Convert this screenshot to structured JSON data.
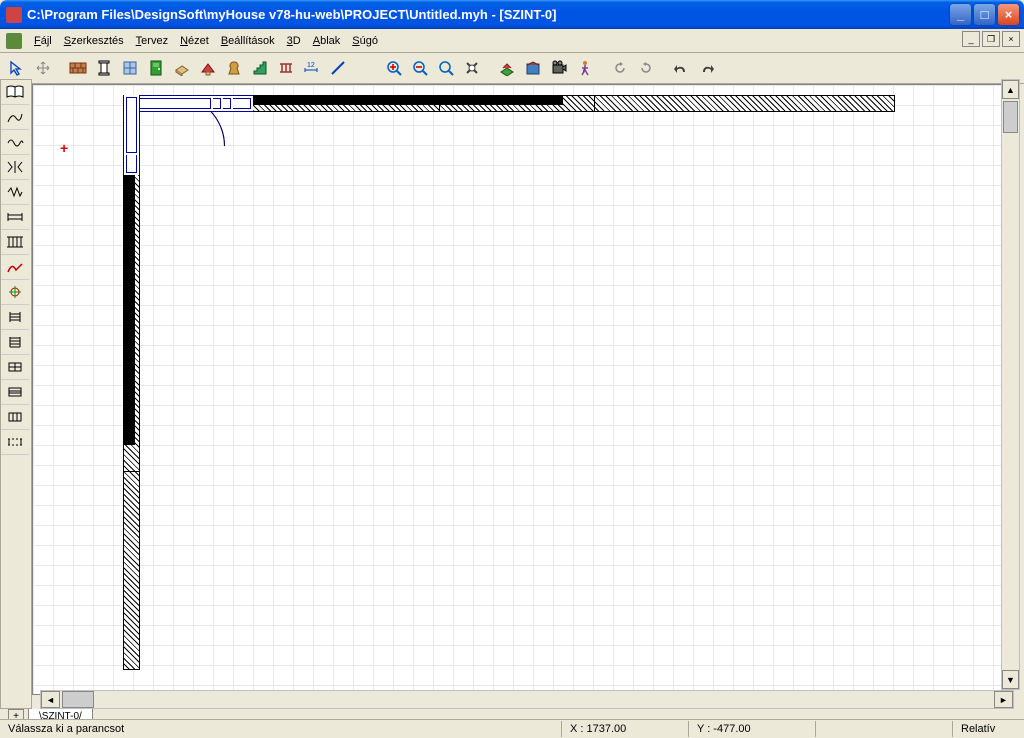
{
  "title": "C:\\Program Files\\DesignSoft\\myHouse v78-hu-web\\PROJECT\\Untitled.myh - [SZINT-0]",
  "menu": {
    "fajl": "Fájl",
    "szerk": "Szerkesztés",
    "tervez": "Tervez",
    "nezet": "Nézet",
    "beall": "Beállítások",
    "d3": "3D",
    "ablak": "Ablak",
    "sugo": "Súgó"
  },
  "tab": "SZINT-0",
  "status": {
    "msg": "Válassza ki a parancsot",
    "x": "X :   1737.00",
    "y": "Y :    -477.00",
    "mode": "Relatív"
  }
}
